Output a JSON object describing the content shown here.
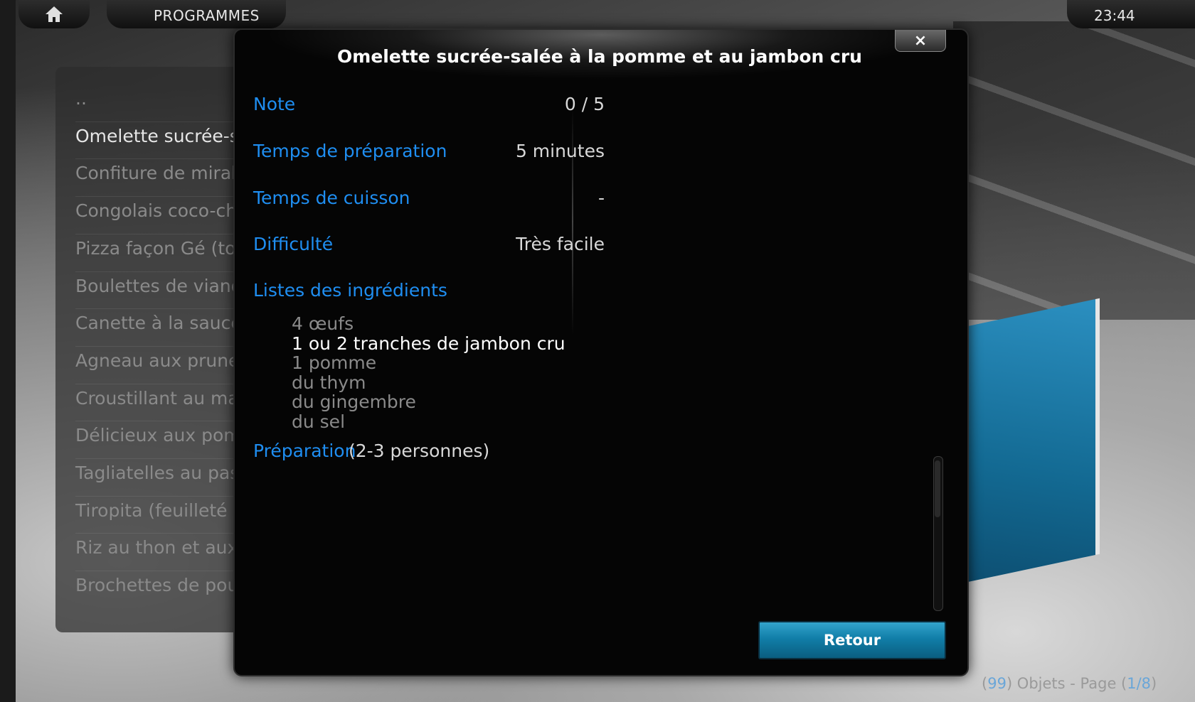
{
  "header": {
    "section_title": "PROGRAMMES",
    "clock": "23:44",
    "home_icon": "home-icon"
  },
  "recipe_list": {
    "items": [
      {
        "label": ".."
      },
      {
        "label": "Omelette sucrée-salée à la pomme et au jambon cru",
        "selected": true
      },
      {
        "label": "Confiture de mirabelles à la cannelle"
      },
      {
        "label": "Congolais coco-chocolat-blanc"
      },
      {
        "label": "Pizza façon Gé (tomate, mozza, lardons et olives"
      },
      {
        "label": "Boulettes de viande au cumin"
      },
      {
        "label": "Canette à la sauce douce"
      },
      {
        "label": "Agneau aux pruneaux et abricots ( L'ham Lahlou de ma..."
      },
      {
        "label": "Croustillant au mascarpone et ricotta"
      },
      {
        "label": "Délicieux aux pommes"
      },
      {
        "label": "Tagliatelles au pastis"
      },
      {
        "label": "Tiropita (feuilleté grec à la feta)"
      },
      {
        "label": "Riz au thon et aux champignons très simple"
      },
      {
        "label": "Brochettes de poulet apéritives sauce soja, miel et sésame"
      }
    ]
  },
  "dialog": {
    "title": "Omelette sucrée-salée à la pomme et au jambon cru",
    "close_label": "×",
    "fields": {
      "note_label": "Note",
      "note_value": "0 / 5",
      "prep_time_label": "Temps de préparation",
      "prep_time_value": "5 minutes",
      "cook_time_label": "Temps de cuisson",
      "cook_time_value": "-",
      "difficulty_label": "Difficulté",
      "difficulty_value": "Très facile",
      "ingredients_label": "Listes des ingrédients",
      "preparation_label": "Préparation",
      "preparation_value": "(2-3 personnes)"
    },
    "ingredients": [
      "4 œufs",
      "1 ou 2 tranches de jambon cru",
      "1 pomme",
      "du thym",
      "du gingembre",
      "du sel"
    ],
    "highlighted_ingredient_index": 1,
    "back_button": "Retour",
    "scroll_position": 0.0
  },
  "footer": {
    "open_paren": "(",
    "count": "99",
    "objects_text": ") Objets - Page (",
    "page": "1/8",
    "close_paren": ")"
  },
  "colors": {
    "accent": "#1f8ef1",
    "button": "#117ea8"
  }
}
